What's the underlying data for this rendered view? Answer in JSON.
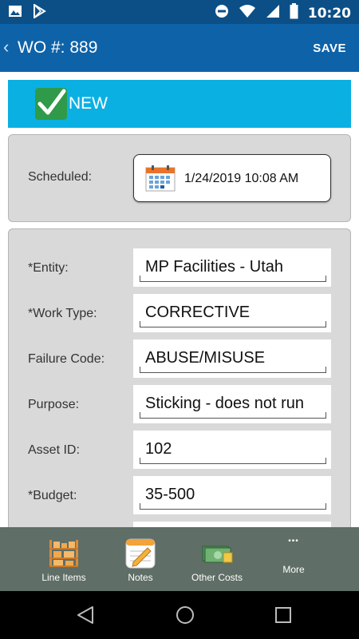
{
  "status_bar": {
    "time": "10:20"
  },
  "app_bar": {
    "back_glyph": "‹",
    "title": "WO #: 889",
    "save_label": "SAVE"
  },
  "status_banner": {
    "label": "NEW"
  },
  "schedule": {
    "label": "Scheduled:",
    "value": "1/24/2019 10:08 AM"
  },
  "fields": [
    {
      "label": "*Entity:",
      "value": "MP Facilities - Utah"
    },
    {
      "label": "*Work Type:",
      "value": "CORRECTIVE"
    },
    {
      "label": "Failure Code:",
      "value": "ABUSE/MISUSE"
    },
    {
      "label": "Purpose:",
      "value": "Sticking - does not run"
    },
    {
      "label": "Asset ID:",
      "value": "102"
    },
    {
      "label": "*Budget:",
      "value": "35-500"
    }
  ],
  "bottom_nav": {
    "items": [
      {
        "label": "Line Items",
        "icon": "shelves-icon"
      },
      {
        "label": "Notes",
        "icon": "notepad-icon"
      },
      {
        "label": "Other Costs",
        "icon": "money-icon"
      },
      {
        "label": "More",
        "icon": "more-dots-icon",
        "glyph": "•••"
      }
    ]
  },
  "colors": {
    "app_bar": "#0e62a8",
    "status_bar": "#0c4f86",
    "banner": "#0bb0e3",
    "check": "#2f9a4a",
    "panel": "#d9d9d9",
    "bottom_nav": "#5f6e66"
  }
}
